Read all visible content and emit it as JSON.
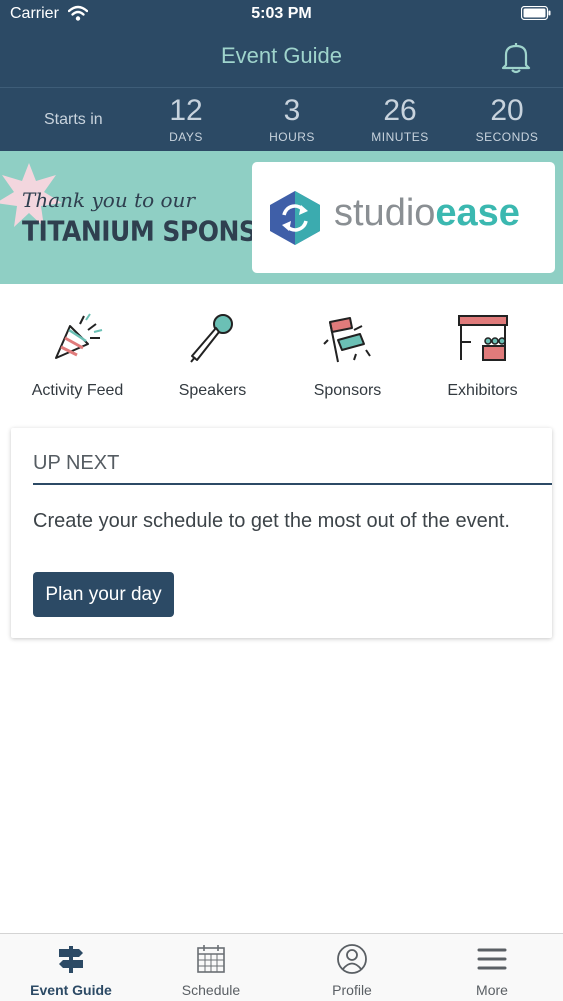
{
  "status_bar": {
    "carrier": "Carrier",
    "time": "5:03 PM"
  },
  "navbar": {
    "title": "Event Guide"
  },
  "countdown": {
    "label": "Starts in",
    "units": [
      {
        "value": "12",
        "unit": "DAYS"
      },
      {
        "value": "3",
        "unit": "HOURS"
      },
      {
        "value": "26",
        "unit": "MINUTES"
      },
      {
        "value": "20",
        "unit": "SECONDS"
      }
    ]
  },
  "sponsor_banner": {
    "thanks_text": "Thank you to our",
    "tier_text": "TITANIUM SPONSOR",
    "logo_text_regular": "studio",
    "logo_text_bold": "ease"
  },
  "quick_links": [
    {
      "label": "Activity Feed",
      "icon": "party-popper-icon"
    },
    {
      "label": "Speakers",
      "icon": "microphone-icon"
    },
    {
      "label": "Sponsors",
      "icon": "pennant-flags-icon"
    },
    {
      "label": "Exhibitors",
      "icon": "booth-icon"
    }
  ],
  "up_next": {
    "title": "UP NEXT",
    "message": "Create your schedule to get the most out of the event.",
    "button_label": "Plan your day"
  },
  "tab_bar": {
    "tabs": [
      {
        "label": "Event Guide",
        "icon": "signpost-icon",
        "active": true
      },
      {
        "label": "Schedule",
        "icon": "calendar-icon",
        "active": false
      },
      {
        "label": "Profile",
        "icon": "profile-icon",
        "active": false
      },
      {
        "label": "More",
        "icon": "menu-icon",
        "active": false
      }
    ]
  },
  "colors": {
    "header_bg": "#2c4a65",
    "title_accent": "#9fd4cc",
    "banner_bg": "#8fcfc4",
    "logo_accent": "#3bb8b0",
    "button_bg": "#2c4a65"
  }
}
